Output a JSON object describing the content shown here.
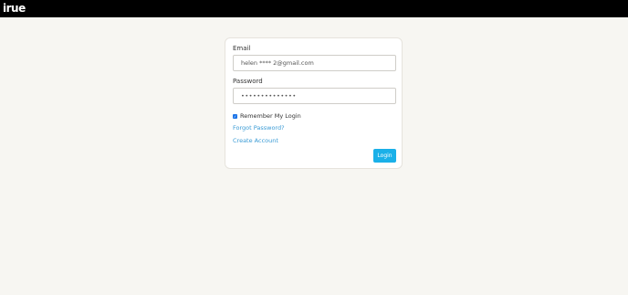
{
  "header": {
    "logo_text": "irue"
  },
  "login_form": {
    "email_label": "Email",
    "email_value": "helen **** 2@gmail.com",
    "password_label": "Password",
    "password_value": "••••••••••••••",
    "remember_label": "Remember My Login",
    "remember_checked": true,
    "forgot_password": "Forgot Password?",
    "create_account": "Create Account",
    "login_button": "Login"
  },
  "colors": {
    "topbar": "#000000",
    "page_background": "#f7f6f2",
    "link": "#3a9bd5",
    "button": "#1ab0e8",
    "checkbox": "#1a73e8"
  }
}
